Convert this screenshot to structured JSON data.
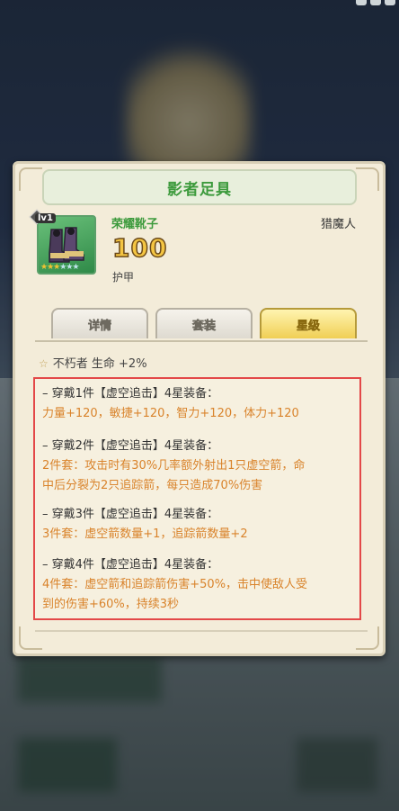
{
  "item": {
    "title": "影者足具",
    "name": "荣耀靴子",
    "class": "猎魔人",
    "power": "100",
    "attribute": "护甲",
    "level": "lv1",
    "star_rating": 3,
    "star_max": 6
  },
  "tabs": [
    {
      "label": "详情",
      "active": false
    },
    {
      "label": "套装",
      "active": false
    },
    {
      "label": "星级",
      "active": true
    }
  ],
  "bonus": {
    "text": "不朽者 生命 +2%"
  },
  "set_bonuses": [
    {
      "head": "– 穿戴1件【虚空追击】4星装备：",
      "body": [
        "力量+120，敏捷+120，智力+120，体力+120"
      ]
    },
    {
      "head": "– 穿戴2件【虚空追击】4星装备：",
      "body": [
        "2件套：攻击时有30%几率额外射出1只虚空箭，命",
        "中后分裂为2只追踪箭，每只造成70%伤害"
      ]
    },
    {
      "head": "– 穿戴3件【虚空追击】4星装备：",
      "body": [
        "3件套：虚空箭数量+1，追踪箭数量+2"
      ]
    },
    {
      "head": "– 穿戴4件【虚空追击】4星装备：",
      "body": [
        "4件套：虚空箭和追踪箭伤害+50%，击中使敌人受",
        "到的伤害+60%，持续3秒"
      ]
    }
  ],
  "colors": {
    "title_green": "#3c9a3c",
    "set_body_orange": "#d9832b",
    "highlight_red": "#e34848",
    "power_gold": "#f4c542"
  }
}
